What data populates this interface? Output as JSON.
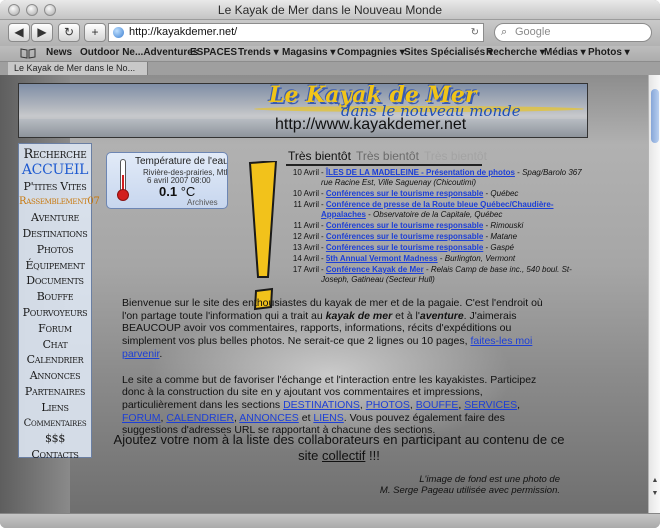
{
  "window": {
    "title": "Le Kayak de Mer dans le Nouveau Monde",
    "url": "http://kayakdemer.net/",
    "search_placeholder": "Google",
    "tab_label": "Le Kayak de Mer dans le No..."
  },
  "bookmarks": [
    "News",
    "Outdoor Ne...Adventures",
    "ESPACES",
    "Trends ▾",
    "Magasins ▾",
    "Compagnies ▾",
    "Sites Spécialisés ▾",
    "Recherche ▾",
    "Médias ▾",
    "Photos ▾"
  ],
  "banner": {
    "title": "Le Kayak de Mer",
    "subtitle": "dans le nouveau monde",
    "url": "http://www.kayakdemer.net"
  },
  "sidebar": {
    "items": [
      "Recherche",
      "ACCUEIL",
      "P'tites Vites",
      "Rassemblement07",
      "Aventure",
      "Destinations",
      "Photos",
      "Équipement",
      "Documents",
      "Bouffe",
      "Pourvoyeurs",
      "Forum",
      "Chat",
      "Calendrier",
      "Annonces",
      "Partenaires",
      "Liens",
      "Commentaires",
      "$$$",
      "Contacts"
    ]
  },
  "temperature": {
    "title": "Température de l'eau",
    "location": "Rivière-des-prairies, Mtl",
    "date": "6 avril 2007 08:00",
    "value": "0.1",
    "unit": "°C",
    "archives": "Archives"
  },
  "event_tabs": [
    "Très bientôt",
    "Très bientôt",
    "Très bientôt"
  ],
  "events": [
    {
      "date": "10 Avril",
      "sep": " - ",
      "link": "ÎLES DE LA MADELEINE - Présentation de photos",
      "after": " - ",
      "loc": "Spag/Barolo 367 rue Racine Est, Ville Saguenay (Chicoutimi)"
    },
    {
      "date": "10 Avril",
      "sep": " - ",
      "link": "Conférences sur le tourisme responsable",
      "after": " - ",
      "loc": "Québec"
    },
    {
      "date": "11 Avril",
      "sep": " - ",
      "link": "Conférence de presse de la Route bleue Québec/Chaudière-Appalaches",
      "after": " - ",
      "loc": "Observatoire de la Capitale, Québec"
    },
    {
      "date": "11 Avril",
      "sep": " - ",
      "link": "Conférences sur le tourisme responsable",
      "after": " - ",
      "loc": "Rimouski"
    },
    {
      "date": "12 Avril",
      "sep": " - ",
      "link": "Conférences sur le tourisme responsable",
      "after": " - ",
      "loc": "Matane"
    },
    {
      "date": "13 Avril",
      "sep": " - ",
      "link": "Conférences sur le tourisme responsable",
      "after": " - ",
      "loc": "Gaspé"
    },
    {
      "date": "14 Avril",
      "sep": " - ",
      "link": "5th Annual Vermont Madness",
      "after": " - ",
      "loc": "Burlington, Vermont"
    },
    {
      "date": "17 Avril",
      "sep": " - ",
      "link": "Conférence Kayak de Mer",
      "after": " - ",
      "loc": "Relais Camp de base inc., 540 boul. St-Joseph, Gatineau (Secteur Hull)"
    }
  ],
  "intro": {
    "p1_a": "Bienvenue sur le site des enthousiastes du kayak de mer et de la pagaie. C'est l'endroit où l'on partage toute l'information qui a trait au ",
    "p1_b1": "kayak de mer",
    "p1_c": " et à l'",
    "p1_b2": "aventure",
    "p1_d": ". J'aimerais BEAUCOUP avoir vos commentaires, rapports, informations, récits d'expéditions ou simplement vos plus belles photos. Ne serait-ce que 2 lignes ou 10 pages, ",
    "p1_link": "faites-les moi parvenir",
    "p1_e": ".",
    "p2_a": "Le site a comme but de favoriser l'échange et l'interaction entre les kayakistes. Participez donc à la construction du site en y ajoutant vos commentaires et impressions, particulièrement dans les sections ",
    "links": [
      "DESTINATIONS",
      "PHOTOS",
      "BOUFFE",
      "SERVICES",
      "FORUM",
      "CALENDRIER",
      "ANNONCES",
      "LIENS"
    ],
    "p2_b": ". Vous pouvez également faire des suggestions d'adresses URL se rapportant à chacune des sections."
  },
  "cta": {
    "a": "Ajoutez votre nom à la liste des collaborateurs en participant au contenu de ce site ",
    "u": "collectif",
    "b": " !!!"
  },
  "credit": {
    "line1": "L'image de fond est une photo de",
    "line2": "M. Serge Pageau utilisée avec permission."
  },
  "colors": {
    "link": "#1d3fd6",
    "accueil": "#1f5bd0",
    "rassemblement": "#c8780c",
    "exclamation": "#f2c21b"
  }
}
